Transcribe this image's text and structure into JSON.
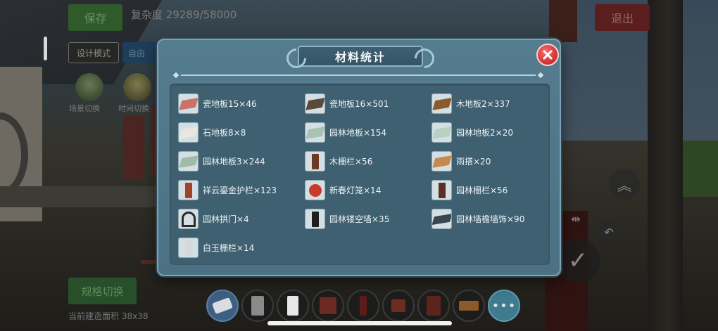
{
  "hud": {
    "save_label": "保存",
    "complexity_text": "复杂度 29289/58000",
    "design_mode_label": "设计模式",
    "free_label": "自由",
    "scene_switch_label": "场景切换",
    "time_switch_label": "时间切换",
    "exit_label": "退出",
    "spec_switch_label": "规格切换",
    "area_text": "当前建造面积 38x38"
  },
  "dialog": {
    "title": "材料统计",
    "items": [
      {
        "name": "瓷地板15×46",
        "icon": "red-tile-floor",
        "color": "#c9726a"
      },
      {
        "name": "瓷地板16×501",
        "icon": "dark-tile-floor",
        "color": "#5a4a3a"
      },
      {
        "name": "木地板2×337",
        "icon": "wood-floor",
        "color": "#8b5a2e"
      },
      {
        "name": "石地板8×8",
        "icon": "stone-floor",
        "color": "#e8e6df"
      },
      {
        "name": "园林地板×154",
        "icon": "garden-floor",
        "color": "#a9c2b3"
      },
      {
        "name": "园林地板2×20",
        "icon": "garden-floor-2",
        "color": "#b9d0c2"
      },
      {
        "name": "园林地板3×244",
        "icon": "garden-floor-3",
        "color": "#9fbca8"
      },
      {
        "name": "木栅栏×56",
        "icon": "wood-fence",
        "color": "#6a3a24"
      },
      {
        "name": "雨搭×20",
        "icon": "rain-canopy",
        "color": "#c48a4f"
      },
      {
        "name": "祥云鎏金护栏×123",
        "icon": "golden-railing",
        "color": "#a0432c"
      },
      {
        "name": "新春灯笼×14",
        "icon": "red-lantern",
        "color": "#c93a2a"
      },
      {
        "name": "园林栅栏×56",
        "icon": "garden-fence",
        "color": "#5a2f2a"
      },
      {
        "name": "园林拱门×4",
        "icon": "garden-archway",
        "color": "#2a2a2a"
      },
      {
        "name": "园林镂空墙×35",
        "icon": "lattice-wall",
        "color": "#1f1f1f"
      },
      {
        "name": "园林墙檐墙饰×90",
        "icon": "wall-eave",
        "color": "#3c4650"
      },
      {
        "name": "白玉栅栏×14",
        "icon": "white-jade-fence",
        "color": "#d8d8d8"
      }
    ]
  },
  "toolbar": {
    "more_label": "•••",
    "slots": [
      {
        "icon": "eraser-icon"
      },
      {
        "icon": "grey-panel-icon"
      },
      {
        "icon": "white-panel-icon"
      },
      {
        "icon": "lattice-icon"
      },
      {
        "icon": "red-post-icon"
      },
      {
        "icon": "railing-icon"
      },
      {
        "icon": "red-screen-icon"
      },
      {
        "icon": "table-icon"
      }
    ]
  }
}
